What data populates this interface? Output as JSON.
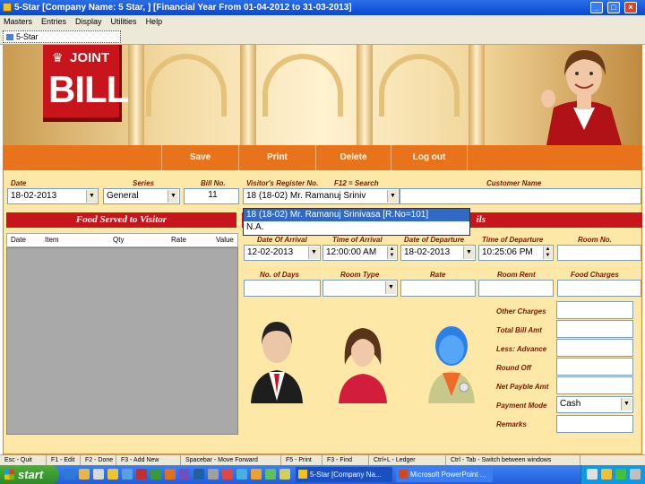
{
  "window": {
    "title": "5-Star [Company Name: 5 Star, ] [Financial Year From 01-04-2012 to 31-03-2013]"
  },
  "menu": [
    "Masters",
    "Entries",
    "Display",
    "Utilities",
    "Help"
  ],
  "mdi_tab": "5-Star",
  "logo": {
    "joint": "JOINT",
    "bill": "BILL"
  },
  "toolbar": {
    "save": "Save",
    "print": "Print",
    "delete": "Delete",
    "logout": "Log out"
  },
  "header_fields": {
    "date_label": "Date",
    "date_value": "18-02-2013",
    "series_label": "Series",
    "series_value": "General",
    "billno_label": "Bill No.",
    "billno_value": "11",
    "register_label": "Visitor's Register No.",
    "register_value": "18 (18-02)  Mr. Ramanuj Sriniv",
    "search_label": "F12 = Search",
    "customer_label": "Customer Name",
    "customer_value": ""
  },
  "register_popup": [
    "18 (18-02)  Mr. Ramanuj Srinivasa [R.No=101]",
    "N.A."
  ],
  "food_section": {
    "title": "Food Served to Visitor",
    "columns": [
      "Date",
      "Item",
      "Qty",
      "Rate",
      "Value"
    ]
  },
  "visitor_section": {
    "title_tail": "ils",
    "arrival_date_label": "Date Of Arrival",
    "arrival_date_value": "12-02-2013",
    "arrival_time_label": "Time of Arrival",
    "arrival_time_value": "12:00:00 AM",
    "departure_date_label": "Date of Departure",
    "departure_date_value": "18-02-2013",
    "departure_time_label": "Time of Departure",
    "departure_time_value": "10:25:06 PM",
    "room_no_label": "Room No.",
    "room_no_value": "",
    "days_label": "No. of Days",
    "room_type_label": "Room Type",
    "rate_label": "Rate",
    "room_rent_label": "Room Rent",
    "food_charges_label": "Food Charges"
  },
  "charges": {
    "other": "Other Charges",
    "total": "Total Bill Amt",
    "advance": "Less: Advance",
    "roundoff": "Round Off",
    "net": "Net Payble Amt",
    "payment_label": "Payment Mode",
    "payment_value": "Cash",
    "remarks": "Remarks"
  },
  "statusbar": [
    "Esc - Quit",
    "F1 - Edit",
    "F2 - Done",
    "F3 - Add New",
    "Spacebar - Move Forward",
    "F5 - Print",
    "F3 - Find",
    "Ctrl+L - Ledger",
    "Ctrl - Tab - Switch between windows"
  ],
  "taskbar": {
    "start": "start",
    "tasks": [
      "5-Star [Company Na...",
      "Microsoft PowerPoint ..."
    ]
  },
  "colors": {
    "accent": "#e8731a",
    "header_red": "#c8151b",
    "form_bg": "#fde8a8"
  }
}
